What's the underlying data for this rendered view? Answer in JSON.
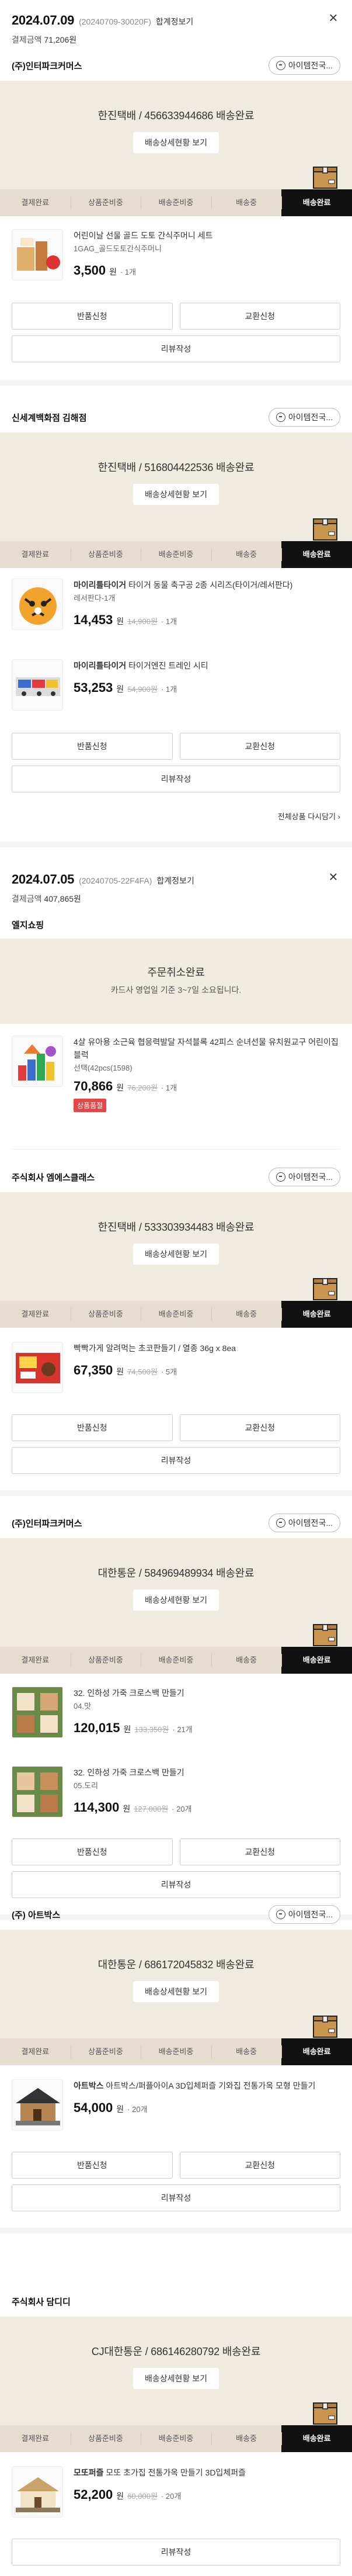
{
  "orders": [
    {
      "date": "2024.07.09",
      "order_no": "(20240709-30020F)",
      "detail_link": "합계정보기",
      "pay_label": "결제금액",
      "pay_amount": "71,206원",
      "close": "×"
    },
    {
      "date": "2024.07.05",
      "order_no": "(20240705-22F4FA)",
      "detail_link": "합계정보기",
      "pay_label": "결제금액",
      "pay_amount": "407,865원",
      "close": "×"
    }
  ],
  "steps": [
    "결제완료",
    "상품준비중",
    "배송준비중",
    "배송중",
    "배송완료"
  ],
  "common": {
    "ask_label": "아이템전국...",
    "track_label": "배송상세현황 보기",
    "return_label": "반품신청",
    "exchange_label": "교환신청",
    "review_label": "리뷰작성",
    "reorder_label": "전체상품 다시담기 ›",
    "won": "원"
  },
  "s1": {
    "seller": "(주)인터파크커머스",
    "status": "한진택배 / 456633944686 배송완료",
    "item": {
      "title": "어린이날 선물 골드 도토 간식주머니 세트",
      "option": "1GAG_골드도토간식주머니",
      "price": "3,500",
      "qty": "· 1개"
    }
  },
  "s2": {
    "seller": "신세계백화점 김해점",
    "status": "한진택배 / 516804422536 배송완료",
    "items": [
      {
        "brand": "마이리틀타이거",
        "title": "타이거 동물 축구공 2종 시리즈(타이거/레서판다)",
        "option": "레서판다-1개",
        "price": "14,453",
        "orig": "14,900원",
        "qty": "· 1개"
      },
      {
        "brand": "마이리틀타이거",
        "title": "타이거엔진 트레인 시티",
        "option": "",
        "price": "53,253",
        "orig": "54,900원",
        "qty": "· 1개"
      }
    ]
  },
  "s3": {
    "seller": "엘지쇼핑",
    "status": "주문취소완료",
    "status_sub": "카드사 영업일 기준 3~7일 소요됩니다.",
    "item": {
      "title": "4살 유아용 소근육 협응력발달 자석블록 42피스 순녀선물 유치원교구 어린이집블럭",
      "option": "선택(42pcs(1598)",
      "price": "70,866",
      "orig": "76,200원",
      "qty": "· 1개",
      "tag": "상품품절"
    }
  },
  "s4": {
    "seller": "주식회사 엠에스클래스",
    "status": "한진택배 / 533303934483 배송완료",
    "item": {
      "title": "빡빡가게 알려먹는 초코판들기 / 열종 36g x 8ea",
      "option": "",
      "price": "67,350",
      "orig": "74,500원",
      "qty": "· 5개"
    }
  },
  "s5": {
    "seller": "(주)인터파크커머스",
    "status": "대한통운 / 584969489934 배송완료",
    "items": [
      {
        "title": "32. 인하성 가죽 크로스백 만들기",
        "option": "04.맛",
        "price": "120,015",
        "orig": "133,350원",
        "qty": "· 21개"
      },
      {
        "title": "32. 인하성 가죽 크로스백 만들기",
        "option": "05.도리",
        "price": "114,300",
        "orig": "127,000원",
        "qty": "· 20개"
      }
    ]
  },
  "s6": {
    "seller": "(주) 아트박스",
    "status": "대한통운 / 686172045832 배송완료",
    "item": {
      "brand": "아트박스",
      "title": "아트박스/퍼플아이A 3D입체퍼즐 기와집 전통가옥 모형 만들기",
      "option": "",
      "price": "54,000",
      "qty": "· 20개"
    }
  },
  "s7": {
    "seller": "주식회사 담디디",
    "status": "CJ대한통운 / 686146280792 배송완료",
    "item": {
      "brand": "모또퍼즐",
      "title": "모또 초가집 전통가옥 만들기 3D입체퍼즐",
      "option": "",
      "price": "52,200",
      "orig": "60,000원",
      "qty": "· 20개"
    }
  }
}
